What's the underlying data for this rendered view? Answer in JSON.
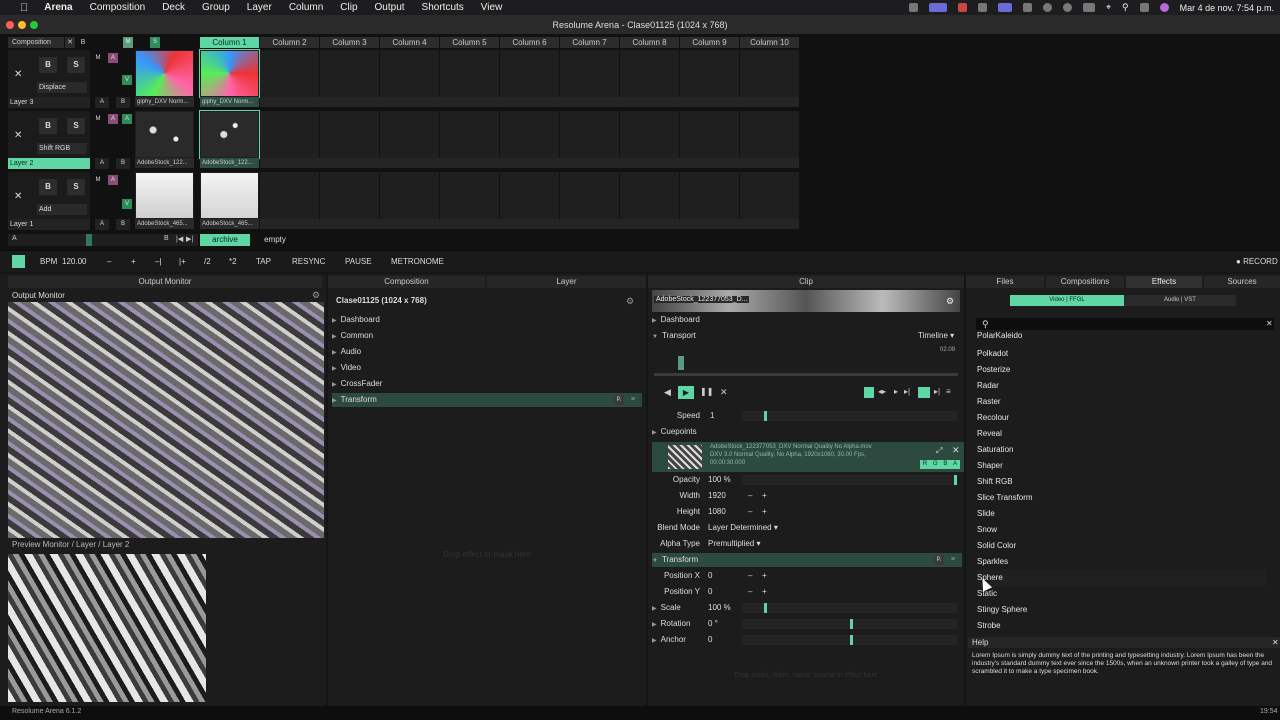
{
  "menubar": {
    "app": "Arena",
    "items": [
      "Composition",
      "Deck",
      "Group",
      "Layer",
      "Column",
      "Clip",
      "Output",
      "Shortcuts",
      "View"
    ],
    "datetime": "Mar 4 de nov.  7:54 p.m."
  },
  "window": {
    "title": "Resolume Arena - Clase01125 (1024 x 768)"
  },
  "deck": {
    "composition_label": "Composition",
    "columns": [
      "Column 1",
      "Column 2",
      "Column 3",
      "Column 4",
      "Column 5",
      "Column 6",
      "Column 7",
      "Column 8",
      "Column 9",
      "Column 10"
    ],
    "layers": [
      {
        "name": "Layer 3",
        "blend": "Displace",
        "clips": [
          "giphy_DXV Norm...",
          "giphy_DXV Norm..."
        ]
      },
      {
        "name": "Layer 2",
        "blend": "Shift RGB",
        "clips": [
          "AdobeStock_122...",
          "AdobeStock_122..."
        ]
      },
      {
        "name": "Layer 1",
        "blend": "Add",
        "clips": [
          "AdobeStock_465...",
          "AdobeStock_465..."
        ]
      }
    ],
    "deck_tabs": [
      "archive",
      "empty"
    ]
  },
  "transport": {
    "bpm_label": "BPM",
    "bpm_value": "120.00",
    "buttons": [
      "–",
      "+",
      "–|",
      "|+",
      "/2",
      "*2",
      "TAP",
      "RESYNC",
      "PAUSE",
      "METRONOME"
    ],
    "record": "RECORD"
  },
  "output_monitor": {
    "title": "Output Monitor",
    "label": "Output Monitor",
    "preview_label": "Preview Monitor / Layer / Layer 2"
  },
  "composition_panel": {
    "tabs": [
      "Composition",
      "Layer"
    ],
    "title": "Clase01125 (1024 x 768)",
    "sections": [
      "Dashboard",
      "Common",
      "Audio",
      "Video",
      "CrossFader",
      "Transform"
    ],
    "drop_hint": "Drop effect or mask here"
  },
  "clip_panel": {
    "tab": "Clip",
    "clip_name": "AdobeStock_122377053_D...",
    "dashboard": "Dashboard",
    "transport_label": "Transport",
    "timeline_label": "Timeline",
    "time": "02.09",
    "speed_label": "Speed",
    "speed_value": "1",
    "cuepoints": "Cuepoints",
    "file_name": "AdobeStock_122377053_DXV Normal Quality No Alpha.mov",
    "file_info1": "DXV 3.0 Normal Quality, No Alpha, 1920x1080, 30.00 Fps,",
    "file_info2": "00:00:30.000",
    "rgba": [
      "R",
      "G",
      "B",
      "A"
    ],
    "params": [
      {
        "label": "Opacity",
        "value": "100 %"
      },
      {
        "label": "Width",
        "value": "1920"
      },
      {
        "label": "Height",
        "value": "1080"
      },
      {
        "label": "Blend Mode",
        "value": "Layer Determined"
      },
      {
        "label": "Alpha Type",
        "value": "Premultiplied"
      }
    ],
    "transform_label": "Transform",
    "transform": [
      {
        "label": "Position X",
        "value": "0"
      },
      {
        "label": "Position Y",
        "value": "0"
      },
      {
        "label": "Scale",
        "value": "100 %"
      },
      {
        "label": "Rotation",
        "value": "0 °"
      },
      {
        "label": "Anchor",
        "value": "0"
      }
    ],
    "drop_hint": "Drop audio, video, mask, source or effect here"
  },
  "browser": {
    "tabs": [
      "Files",
      "Compositions",
      "Effects",
      "Sources"
    ],
    "subtabs": [
      "Video | FFGL",
      "Audio | VST"
    ],
    "search_placeholder": "",
    "effects": [
      "PolarKaleido",
      "Polkadot",
      "Posterize",
      "Radar",
      "Raster",
      "Recolour",
      "Reveal",
      "Saturation",
      "Shaper",
      "Shift RGB",
      "Slice Transform",
      "Slide",
      "Snow",
      "Solid Color",
      "Sparkles",
      "Sphere",
      "Static",
      "Stingy Sphere",
      "Strobe"
    ],
    "help_title": "Help",
    "help_text": "Lorem Ipsum is simply dummy text of the printing and typesetting industry. Lorem Ipsum has been the industry's standard dummy text ever since the 1500s, when an unknown printer took a galley of type and scrambled it to make a type specimen book."
  },
  "statusbar": {
    "version": "Resolume Arena 6.1.2",
    "clock": "19:54"
  },
  "colors": {
    "accent": "#5fd6a4",
    "bg": "#151515"
  }
}
